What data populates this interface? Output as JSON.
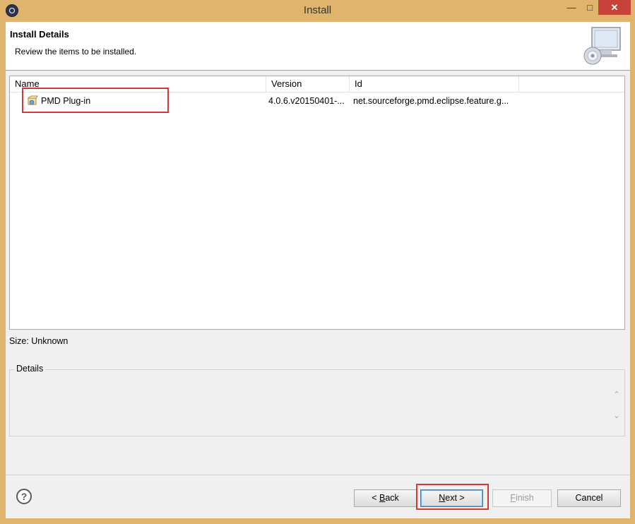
{
  "window": {
    "title": "Install",
    "minimize_glyph": "—",
    "maximize_glyph": "□",
    "close_glyph": "✕"
  },
  "banner": {
    "title": "Install Details",
    "subtitle": "Review the items to be installed."
  },
  "table": {
    "columns": [
      "Name",
      "Version",
      "Id"
    ],
    "rows": [
      {
        "name": "PMD Plug-in",
        "version": "4.0.6.v20150401-...",
        "id": "net.sourceforge.pmd.eclipse.feature.g..."
      }
    ]
  },
  "size_label": "Size: Unknown",
  "details": {
    "legend": "Details"
  },
  "buttons": {
    "help": "?",
    "back_prefix": "< ",
    "back_accel": "B",
    "back_rest": "ack",
    "next_accel": "N",
    "next_rest": "ext >",
    "finish_accel": "F",
    "finish_rest": "inish",
    "cancel": "Cancel"
  },
  "colors": {
    "window_frame": "#e0b46d",
    "close_button": "#c7433a",
    "highlight": "#d23a3a"
  }
}
